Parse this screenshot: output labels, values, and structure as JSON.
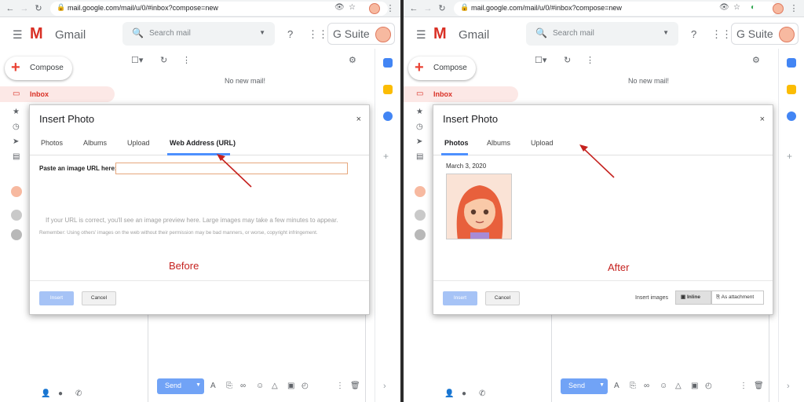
{
  "browser": {
    "url": "mail.google.com/mail/u/0/#inbox?compose=new"
  },
  "gmail": {
    "logo_letter": "M",
    "logo_text": "Gmail",
    "search_placeholder": "Search mail",
    "gsuite_label": "G Suite",
    "compose_label": "Compose",
    "inbox_label": "Inbox",
    "no_mail": "No new mail!",
    "send_label": "Send"
  },
  "left_panel": {
    "dialog_title": "Insert Photo",
    "close": "×",
    "tabs": [
      "Photos",
      "Albums",
      "Upload",
      "Web Address (URL)"
    ],
    "active_tab": "Web Address (URL)",
    "url_label": "Paste an image URL here:",
    "url_value": "",
    "hint": "If your URL is correct, you'll see an image preview here. Large images may take a few minutes to appear.",
    "remember": "Remember: Using others' images on the web without their permission may be bad manners, or worse, copyright infringement.",
    "caption": "Before",
    "insert_button": "Insert",
    "cancel_button": "Cancel"
  },
  "right_panel": {
    "dialog_title": "Insert Photo",
    "close": "×",
    "tabs": [
      "Photos",
      "Albums",
      "Upload"
    ],
    "active_tab": "Photos",
    "date": "March 3, 2020",
    "caption": "After",
    "insert_button": "Insert",
    "cancel_button": "Cancel",
    "insert_images_label": "Insert images",
    "inline_option": "Inline",
    "attachment_option": "As attachment"
  },
  "colors": {
    "accent": "#4d90fe",
    "annotation": "#c5221f",
    "brand": "#d93025"
  }
}
